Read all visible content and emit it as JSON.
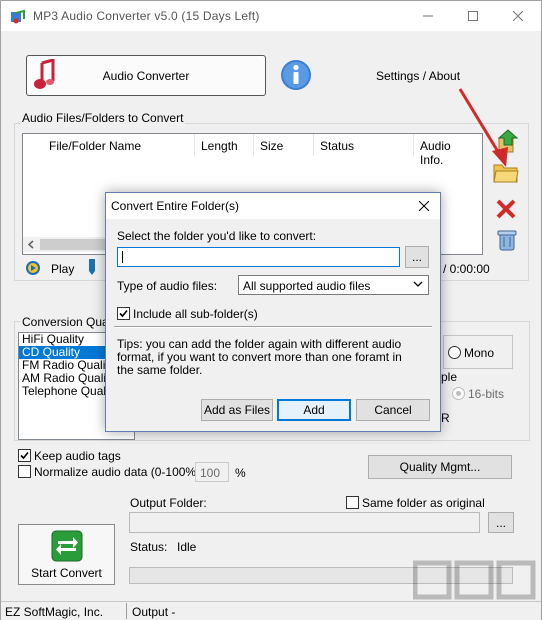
{
  "window": {
    "title": "MP3 Audio Converter v5.0 (15 Days Left)",
    "icons": {
      "minimize": "minimize-icon",
      "maximize": "maximize-icon",
      "close": "close-icon"
    }
  },
  "top": {
    "audio_converter_label": "Audio Converter",
    "settings_label": "Settings / About",
    "icons": {
      "music": "music-note-icon",
      "info": "info-icon"
    }
  },
  "files_section": {
    "title": "Audio Files/Folders to Convert",
    "columns": [
      "File/Folder Name",
      "Length",
      "Size",
      "Status",
      "Audio Info."
    ],
    "side_icons": [
      "add-files-icon",
      "add-folder-icon",
      "remove-icon",
      "clear-list-icon"
    ]
  },
  "player": {
    "play_label": "Play",
    "time": "/ 0:00:00",
    "icons": {
      "play": "play-icon",
      "volume": "volume-slider-icon"
    }
  },
  "quality": {
    "title": "Conversion Quality",
    "items": [
      "HiFi Quality",
      "CD Quality",
      "FM Radio Quality",
      "AM Radio Quality",
      "Telephone Quality"
    ],
    "selected": "CD Quality",
    "mono_label": "Mono",
    "sample_partial": "ple",
    "bits_label": "16-bits",
    "r_partial": "R",
    "keep_tags_label": "Keep audio tags",
    "normalize_label": "Normalize audio data (0-100%):",
    "normalize_value": "100",
    "percent": "%",
    "quality_mgmt_label": "Quality Mgmt..."
  },
  "output": {
    "folder_label": "Output Folder:",
    "same_folder_label": "Same folder as original",
    "browse_label": "...",
    "status_label": "Status:",
    "status_value": "Idle",
    "start_label": "Start Convert",
    "icons": {
      "start": "convert-arrows-icon"
    }
  },
  "statusbar": {
    "company": "EZ SoftMagic, Inc.",
    "output": "Output -"
  },
  "dialog": {
    "title": "Convert Entire Folder(s)",
    "select_prompt": "Select the folder you'd like to convert:",
    "folder_value": "",
    "browse_label": "...",
    "type_label": "Type of audio files:",
    "type_value": "All supported audio files",
    "include_sub_label": "Include all sub-folder(s)",
    "include_sub_checked": true,
    "tips": "Tips: you can add the folder again with different audio format, if you want to convert more than one foramt in the same folder.",
    "add_as_files_label": "Add as Files",
    "add_label": "Add",
    "cancel_label": "Cancel"
  },
  "colors": {
    "selection": "#0078d7",
    "window_bg": "#f0f0f0",
    "accent_red": "#d12a2a",
    "accent_green": "#2a9d3a"
  }
}
